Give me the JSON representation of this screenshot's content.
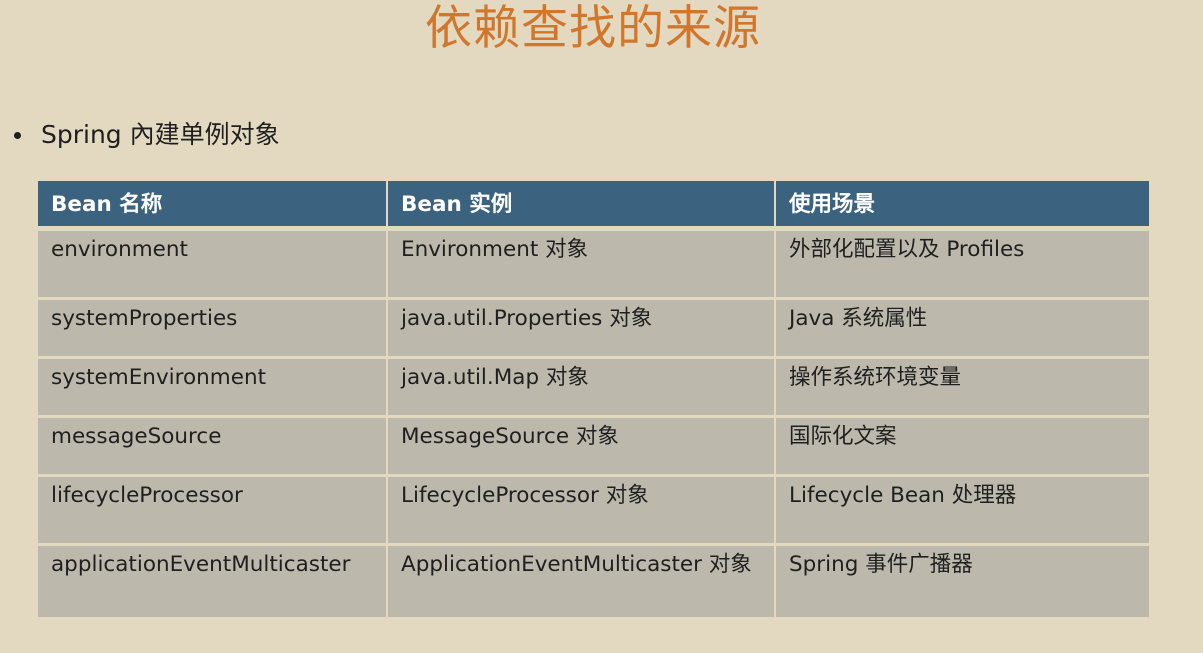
{
  "slide": {
    "title": "依赖查找的来源",
    "bullet": "Spring 內建单例对象"
  },
  "table": {
    "headers": [
      "Bean 名称",
      "Bean 实例",
      "使用场景"
    ],
    "rows": [
      [
        "environment",
        "Environment 对象",
        "外部化配置以及 Profiles"
      ],
      [
        "systemProperties",
        "java.util.Properties 对象",
        "Java 系统属性"
      ],
      [
        "systemEnvironment",
        "java.util.Map 对象",
        "操作系统环境变量"
      ],
      [
        "messageSource",
        "MessageSource 对象",
        "国际化文案"
      ],
      [
        "lifecycleProcessor",
        "LifecycleProcessor 对象",
        "Lifecycle Bean 处理器"
      ],
      [
        "applicationEventMulticaster",
        "ApplicationEventMulticaster 对象",
        "Spring 事件广播器"
      ]
    ]
  },
  "colors": {
    "background": "#e2d9c0",
    "title": "#d2762c",
    "header": "#3b627f",
    "cell": "#bcb9ac"
  }
}
